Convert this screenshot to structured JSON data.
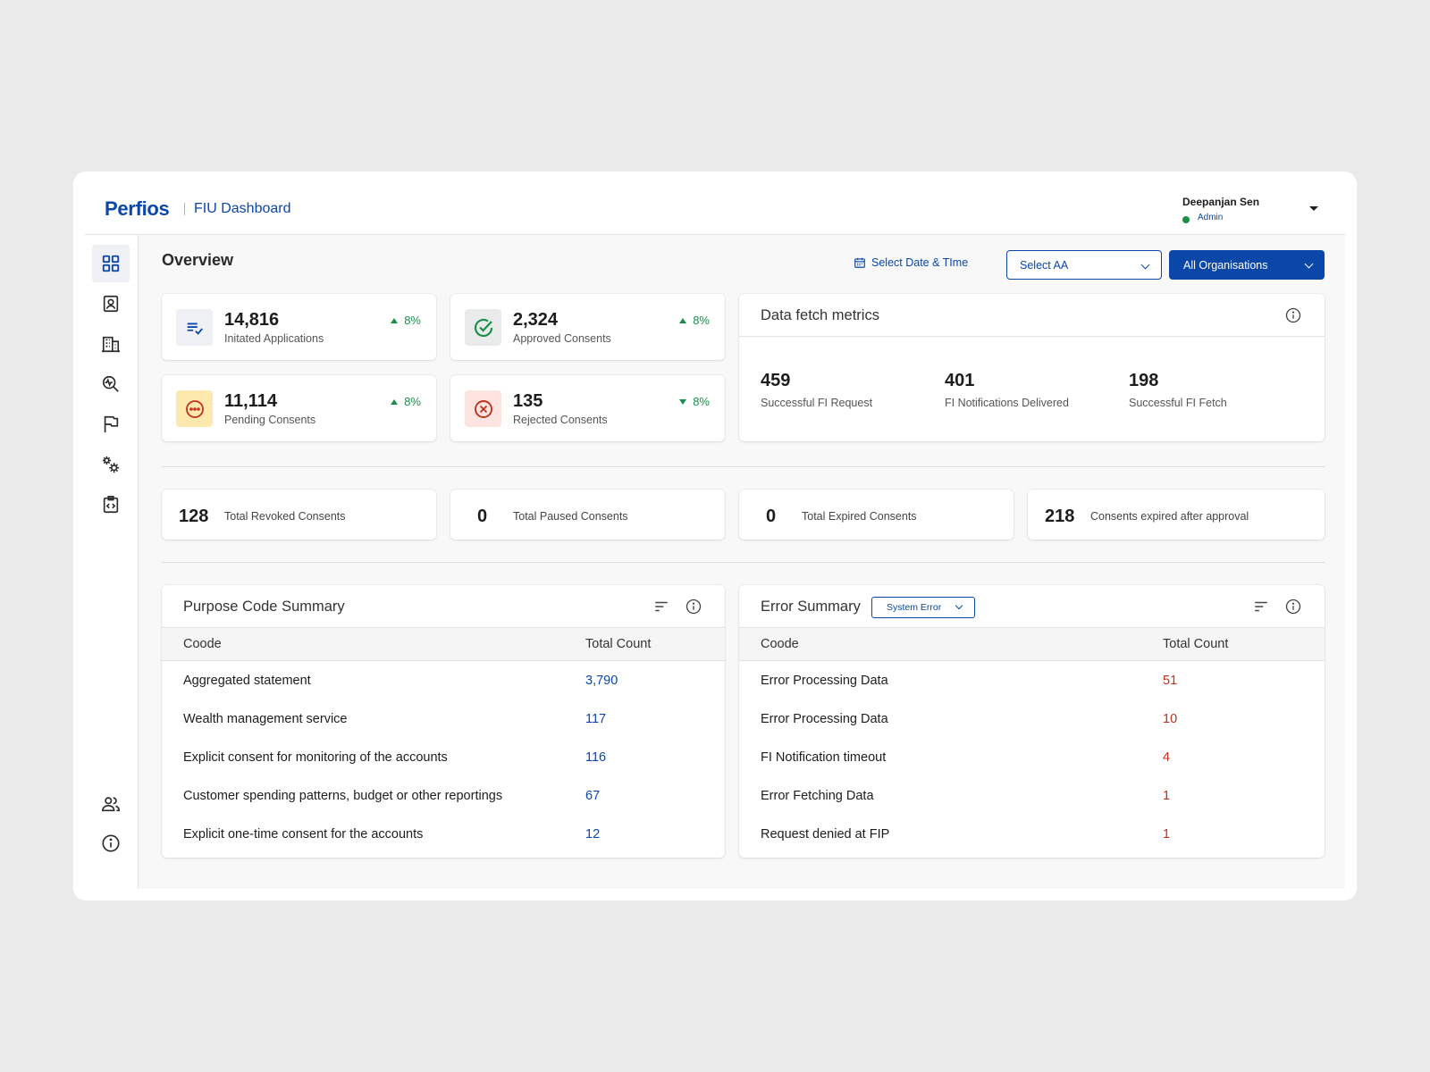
{
  "header": {
    "logo": "Perfios",
    "title": "FIU Dashboard",
    "user_name": "Deepanjan Sen",
    "user_role": "Admin"
  },
  "sidebar": {
    "items": [
      {
        "icon": "grid-icon",
        "active": true
      },
      {
        "icon": "profile-icon",
        "active": false
      },
      {
        "icon": "building-icon",
        "active": false
      },
      {
        "icon": "search-analytics-icon",
        "active": false
      },
      {
        "icon": "flag-icon",
        "active": false
      },
      {
        "icon": "settings-gears-icon",
        "active": false
      },
      {
        "icon": "code-clipboard-icon",
        "active": false
      },
      {
        "icon": "users-icon",
        "active": false
      },
      {
        "icon": "info-icon",
        "active": false
      }
    ]
  },
  "toolbar": {
    "page_title": "Overview",
    "date_label": "Select Date & TIme",
    "select_aa": "Select AA",
    "organisations": "All Organisations"
  },
  "stats": [
    {
      "value": "14,816",
      "label": "Initated Applications",
      "trend": "8%",
      "direction": "up",
      "icon": "list-check-icon"
    },
    {
      "value": "2,324",
      "label": "Approved Consents",
      "trend": "8%",
      "direction": "up",
      "icon": "check-circle-icon"
    },
    {
      "value": "11,114",
      "label": "Pending Consents",
      "trend": "8%",
      "direction": "up",
      "icon": "pending-dots-icon"
    },
    {
      "value": "135",
      "label": "Rejected Consents",
      "trend": "8%",
      "direction": "down",
      "icon": "x-circle-icon"
    }
  ],
  "data_fetch": {
    "title": "Data fetch metrics",
    "metrics": [
      {
        "value": "459",
        "label": "Successful FI Request"
      },
      {
        "value": "401",
        "label": "FI Notifications Delivered"
      },
      {
        "value": "198",
        "label": "Successful FI Fetch"
      }
    ]
  },
  "totals": [
    {
      "value": "128",
      "label": "Total Revoked Consents"
    },
    {
      "value": "0",
      "label": "Total Paused Consents"
    },
    {
      "value": "0",
      "label": "Total Expired Consents"
    },
    {
      "value": "218",
      "label": "Consents expired after approval"
    }
  ],
  "purpose_summary": {
    "title": "Purpose Code Summary",
    "col_code": "Coode",
    "col_count": "Total Count",
    "rows": [
      {
        "code": "Aggregated statement",
        "count": "3,790"
      },
      {
        "code": "Wealth management service",
        "count": "117"
      },
      {
        "code": "Explicit consent for monitoring of the accounts",
        "count": "116"
      },
      {
        "code": "Customer spending patterns, budget or other reportings",
        "count": "67"
      },
      {
        "code": "Explicit one-time consent for the accounts",
        "count": "12"
      }
    ]
  },
  "error_summary": {
    "title": "Error Summary",
    "filter": "System Error",
    "col_code": "Coode",
    "col_count": "Total Count",
    "rows": [
      {
        "code": "Error Processing Data",
        "count": "51"
      },
      {
        "code": "Error Processing Data",
        "count": "10"
      },
      {
        "code": "FI Notification timeout",
        "count": "4"
      },
      {
        "code": "Error Fetching Data",
        "count": "1"
      },
      {
        "code": "Request denied at FIP",
        "count": "1"
      }
    ]
  },
  "colors": {
    "brand": "#0a47a8",
    "positive": "#1a8f4b",
    "error": "#c0311f",
    "pending_bg": "#fde9ad",
    "rejected_bg": "#fde4e1"
  }
}
